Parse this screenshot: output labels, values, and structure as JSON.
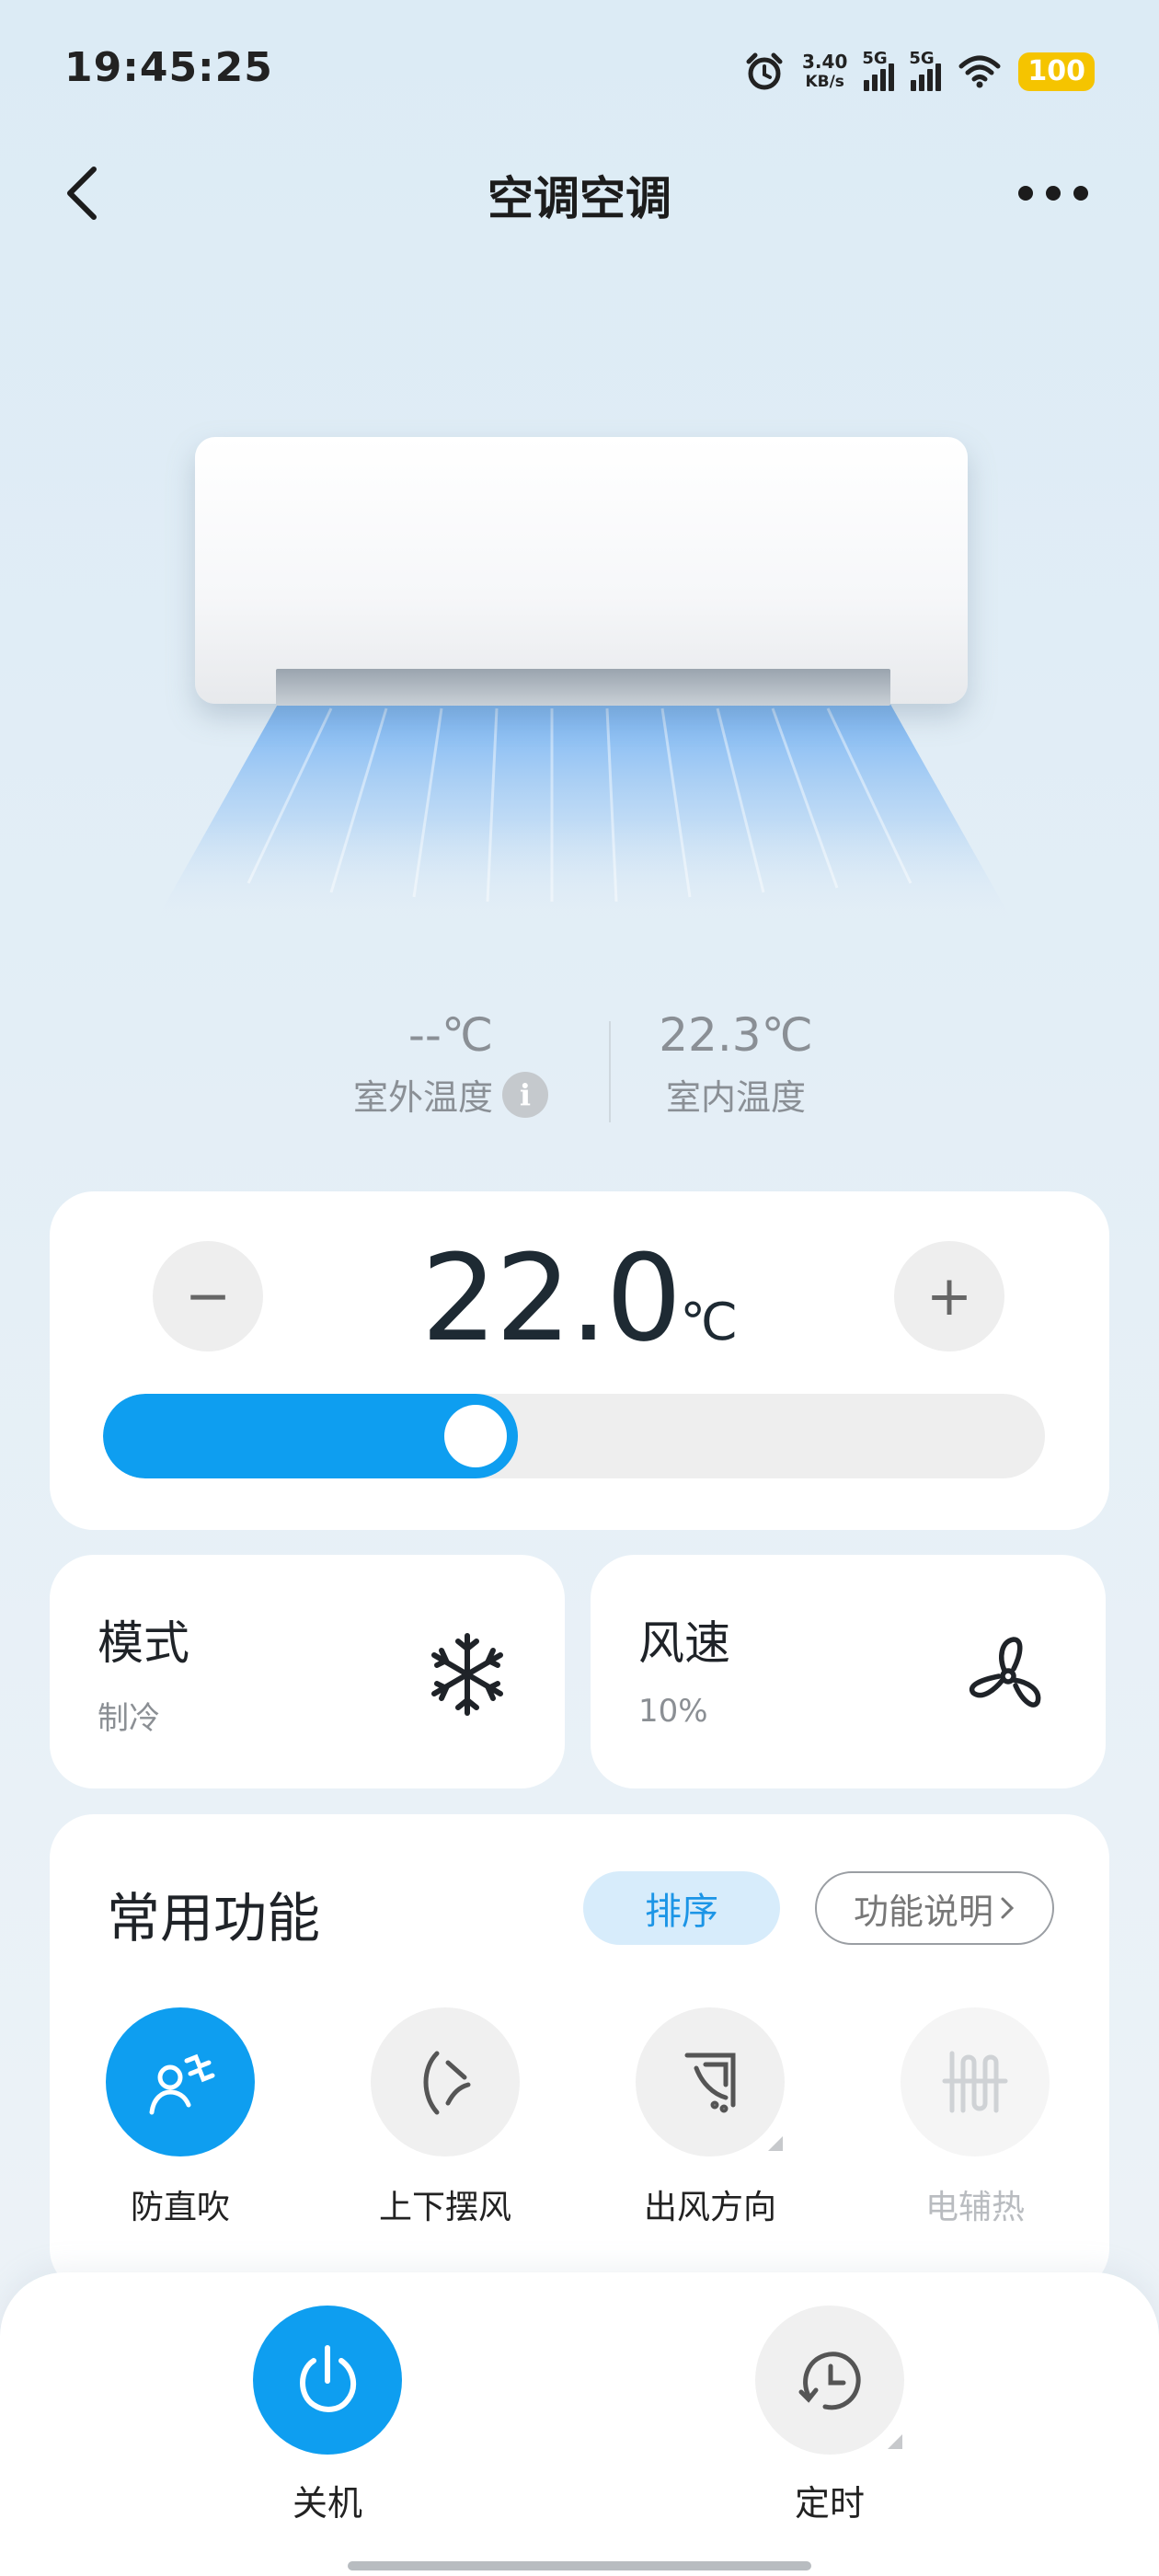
{
  "status_bar": {
    "time": "19:45:25",
    "net_speed_value": "3.40",
    "net_speed_unit": "KB/s",
    "signal1_label": "5G",
    "signal2_label": "5G",
    "battery": "100",
    "icons": [
      "alarm-icon",
      "signal-icon",
      "wifi-icon",
      "battery-icon"
    ]
  },
  "header": {
    "title": "空调空调",
    "back_icon": "back-chevron-icon",
    "more_icon": "more-dots-icon"
  },
  "temps": {
    "outdoor_value": "--℃",
    "outdoor_label": "室外温度",
    "indoor_value": "22.3℃",
    "indoor_label": "室内温度"
  },
  "temperature_control": {
    "value": "22.0",
    "unit": "℃",
    "minus_label": "−",
    "plus_label": "+",
    "slider_fraction": 0.44
  },
  "mode_card": {
    "title": "模式",
    "value": "制冷",
    "icon": "snowflake-icon"
  },
  "fan_card": {
    "title": "风速",
    "value": "10%",
    "icon": "fan-icon"
  },
  "functions": {
    "title": "常用功能",
    "sort_label": "排序",
    "help_label": "功能说明",
    "items": [
      {
        "label": "防直吹",
        "icon": "anti-direct-blow-icon",
        "state": "active"
      },
      {
        "label": "上下摆风",
        "icon": "vertical-swing-icon",
        "state": "normal"
      },
      {
        "label": "出风方向",
        "icon": "air-direction-icon",
        "state": "normal"
      },
      {
        "label": "电辅热",
        "icon": "electric-heating-icon",
        "state": "disabled"
      }
    ]
  },
  "bottom_bar": {
    "power_label": "关机",
    "timer_label": "定时"
  },
  "colors": {
    "accent": "#0e9ef0",
    "background": "#dcebf5",
    "battery": "#f5c400"
  }
}
